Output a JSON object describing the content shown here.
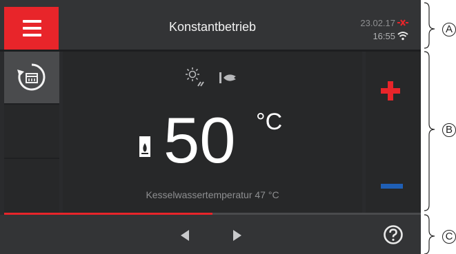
{
  "header": {
    "title": "Konstantbetrieb",
    "date": "23.02.17",
    "time": "16:55"
  },
  "main": {
    "temperature": "50",
    "unit": "°C",
    "subtitle": "Kesselwassertemperatur 47 °C"
  },
  "progress": {
    "value": 0.5
  },
  "callouts": [
    "A",
    "B",
    "C"
  ],
  "colors": {
    "accent_red": "#e8252a",
    "minus_blue": "#1f5fb5",
    "background": "#2a2b2d",
    "text_muted": "#8e8f91"
  },
  "icons": {
    "menu": "hamburger-menu-icon",
    "error": "connection-error-icon",
    "wifi": "wifi-icon",
    "program": "timer-program-icon",
    "mode_sun": "sun-mode-icon",
    "burner": "burner-flame-icon",
    "dhw": "hot-water-tank-icon",
    "prev": "triangle-left-icon",
    "next": "triangle-right-icon",
    "help": "question-circle-icon"
  }
}
